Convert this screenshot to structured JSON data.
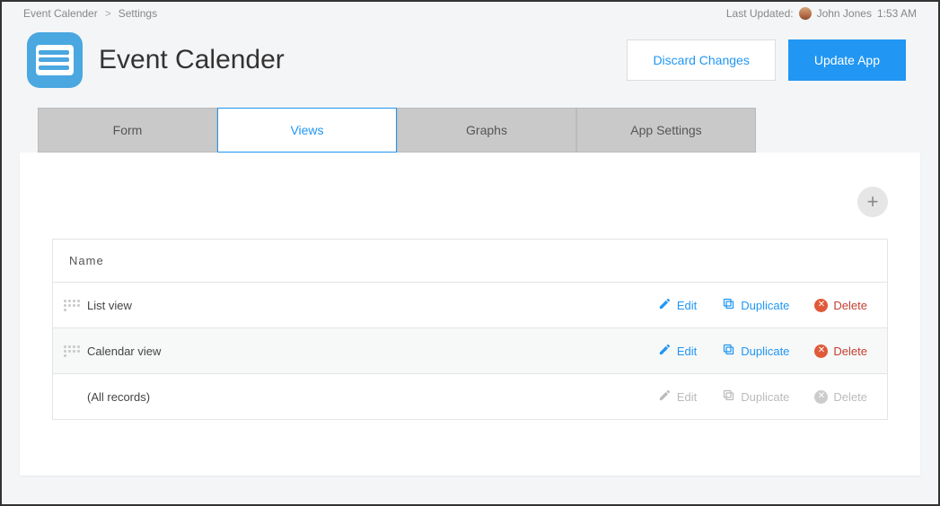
{
  "breadcrumb": {
    "item0": "Event Calender",
    "sep": ">",
    "item1": "Settings"
  },
  "topbar": {
    "last_updated_label": "Last Updated:",
    "user_name": "John Jones",
    "time": "1:53 AM"
  },
  "header": {
    "title": "Event Calender",
    "discard_label": "Discard Changes",
    "update_label": "Update App"
  },
  "tabs": {
    "form": "Form",
    "views": "Views",
    "graphs": "Graphs",
    "settings": "App Settings"
  },
  "panel": {
    "add_symbol": "+",
    "name_header": "Name",
    "actions": {
      "edit": "Edit",
      "duplicate": "Duplicate",
      "delete": "Delete"
    },
    "rows": [
      {
        "name": "List view",
        "draggable": true,
        "disabled": false
      },
      {
        "name": "Calendar view",
        "draggable": true,
        "disabled": false
      },
      {
        "name": "(All records)",
        "draggable": false,
        "disabled": true
      }
    ]
  }
}
